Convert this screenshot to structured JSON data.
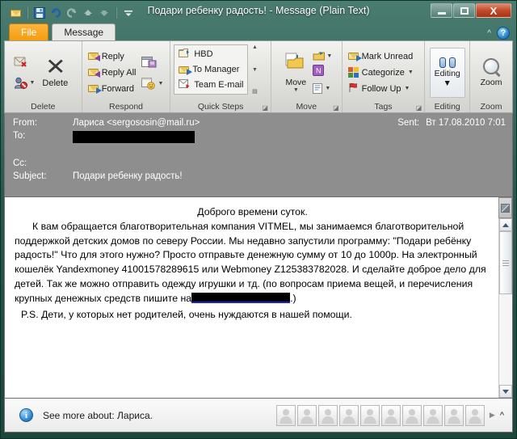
{
  "window": {
    "title": "Подари ребенку радость!  -  Message (Plain Text)",
    "minimize_label": "Minimize",
    "maximize_label": "Maximize",
    "close_label": "X",
    "accent_title_bg": "#2a574e",
    "accent_file_tab": "#f59c10"
  },
  "quick_access": [
    {
      "name": "mail-icon",
      "label": "Mail"
    },
    {
      "name": "save-icon",
      "label": "Save"
    },
    {
      "name": "undo-icon",
      "label": "Undo"
    },
    {
      "name": "redo-icon",
      "label": "Redo"
    },
    {
      "name": "previous-item-icon",
      "label": "Previous Item"
    },
    {
      "name": "next-item-icon",
      "label": "Next Item"
    },
    {
      "name": "customize-qat-icon",
      "label": "Customize Quick Access Toolbar"
    }
  ],
  "tabs": {
    "file": "File",
    "message": "Message",
    "collapse_ribbon": "^",
    "help": "?"
  },
  "ribbon": {
    "groups": [
      {
        "name": "delete",
        "label": "Delete",
        "items": [
          {
            "label": "Ignore",
            "icon": "ignore-icon"
          },
          {
            "label": "Junk",
            "icon": "junk-icon"
          },
          {
            "label": "Delete",
            "icon": "delete-x-icon"
          }
        ]
      },
      {
        "name": "respond",
        "label": "Respond",
        "items": [
          {
            "label": "Reply",
            "icon": "reply-icon"
          },
          {
            "label": "Reply All",
            "icon": "reply-all-icon"
          },
          {
            "label": "Forward",
            "icon": "forward-icon"
          },
          {
            "label": "Meeting",
            "icon": "meeting-icon"
          },
          {
            "label": "More",
            "icon": "more-respond-icon"
          }
        ]
      },
      {
        "name": "quick-steps",
        "label": "Quick Steps",
        "items": [
          {
            "label": "HBD",
            "icon": "hbd-icon"
          },
          {
            "label": "To Manager",
            "icon": "to-manager-icon"
          },
          {
            "label": "Team E-mail",
            "icon": "team-email-icon"
          }
        ]
      },
      {
        "name": "move",
        "label": "Move",
        "items": [
          {
            "label": "Move",
            "icon": "move-icon"
          },
          {
            "label": "Rules",
            "icon": "rules-icon"
          },
          {
            "label": "OneNote",
            "icon": "onenote-icon"
          },
          {
            "label": "Actions",
            "icon": "actions-icon"
          }
        ]
      },
      {
        "name": "tags",
        "label": "Tags",
        "items": [
          {
            "label": "Mark Unread",
            "icon": "mark-unread-icon"
          },
          {
            "label": "Categorize",
            "icon": "categorize-icon"
          },
          {
            "label": "Follow Up",
            "icon": "follow-up-icon"
          }
        ]
      },
      {
        "name": "editing",
        "label": "Editing",
        "items": [
          {
            "label": "Editing",
            "icon": "editing-icon"
          }
        ]
      },
      {
        "name": "zoom",
        "label": "Zoom",
        "items": [
          {
            "label": "Zoom",
            "icon": "zoom-magnifier-icon"
          }
        ]
      }
    ]
  },
  "headers": {
    "from_label": "From:",
    "from_value": "Лариса <sergososin@mail.ru>",
    "to_label": "To:",
    "to_value_redacted": true,
    "cc_label": "Cc:",
    "cc_value": "",
    "subject_label": "Subject:",
    "subject_value": "Подари ребенку радость!",
    "sent_label": "Sent:",
    "sent_value": "Вт 17.08.2010 7:01"
  },
  "body": {
    "greeting": "Доброго времени суток.",
    "paragraph": "К вам обращается благотворительная компания VITMEL, мы занимаемся благотворительной поддержкой детских домов по северу России. Мы недавно запустили программу: \"Подари ребёнку радость!\" Что для этого нужно? Просто отправьте денежную сумму от 10 до 1000р. На электронный кошелёк Yandexmoney 41001578289615 или Webmoney Z125383782028. И сделайте доброе дело для детей. Так же можно отправить одежду  игрушки и тд. (по вопросам приема вещей, и перечисления крупных денежных средств пишите на",
    "paragraph_tail": ".)",
    "postscript": "P.S.  Дети, у которых нет родителей, очень нуждаются в нашей помощи.",
    "email_redacted": true
  },
  "people_pane": {
    "info_glyph": "i",
    "see_more_text": "See more about: Лариса.",
    "avatar_count": 10,
    "more_arrow": "▶",
    "expand_arrow": "^"
  }
}
